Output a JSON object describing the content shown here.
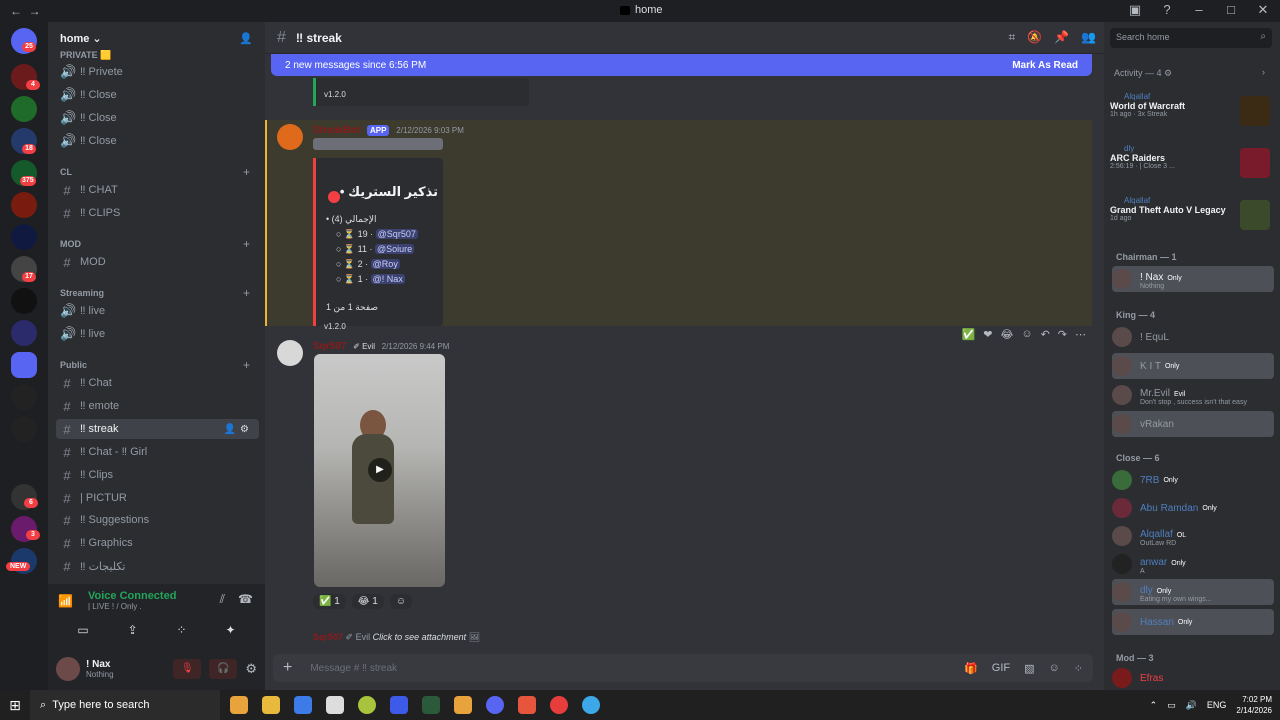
{
  "titlebar": {
    "title": "home"
  },
  "servers": {
    "dm_badge": "25",
    "badges": [
      "4",
      "18",
      "375",
      "17",
      "6",
      "3"
    ],
    "new_label": "NEW"
  },
  "guild": {
    "name": "home ⌄"
  },
  "categories": {
    "private": "PRIVATE 🟨",
    "cl": "CL",
    "mod": "MOD",
    "streaming": "Streaming",
    "public": "Public"
  },
  "channels": [
    {
      "name": "‼ Privete"
    },
    {
      "name": "‼ Close"
    },
    {
      "name": "‼ Close"
    },
    {
      "name": "‼ Close"
    },
    {
      "name": "‼ CHAT"
    },
    {
      "name": "‼ CLIPS"
    },
    {
      "name": "MOD"
    },
    {
      "name": "‼ live"
    },
    {
      "name": "‼ live"
    },
    {
      "name": "‼ Chat"
    },
    {
      "name": "‼ emote"
    },
    {
      "name": "‼ streak"
    },
    {
      "name": "‼ Chat - ‼ Girl"
    },
    {
      "name": "‼ Clips"
    },
    {
      "name": "| PICTUR"
    },
    {
      "name": "‼ Suggestions"
    },
    {
      "name": "‼ Graphics"
    },
    {
      "name": "‼ تكليجات"
    }
  ],
  "voice": {
    "status": "Voice Connected",
    "sub": "| LIVE ! / Only ."
  },
  "user": {
    "name": "! Nax",
    "status": "Nothing"
  },
  "chat": {
    "channel": "‼ streak",
    "banner": "2 new messages since 6:56 PM",
    "mark_read": "Mark As Read",
    "top_version": "v1.2.0",
    "bot_name": "StreakBot",
    "bot_tag": "APP",
    "bot_time": "2/12/2026 9:03 PM",
    "embed_title": "تذكير الستريك •",
    "embed_total": "الإجمالي (4)",
    "embed_rows": [
      {
        "count": "19",
        "mention": "@Sqr507"
      },
      {
        "count": "11",
        "mention": "@Soiure"
      },
      {
        "count": "2",
        "mention": "@Roy"
      },
      {
        "count": "1",
        "mention": "@! Nax"
      }
    ],
    "embed_page": "صفحة 1 من 1",
    "embed_version": "v1.2.0",
    "msg2_author": "Sqr507",
    "msg2_tag": "Evil",
    "msg2_time": "2/12/2026 9:44 PM",
    "reactions": [
      {
        "emoji": "✅",
        "count": "1"
      },
      {
        "emoji": "😂",
        "count": "1"
      }
    ],
    "reply_author": "Sqr507",
    "reply_tag": "Evil",
    "reply_text": "Click to see attachment",
    "composer_placeholder": "Message # ‼ streak"
  },
  "members": {
    "search_placeholder": "Search home",
    "activity_head": "Activity — 4",
    "activities": [
      {
        "who": "Alqallaf",
        "game": "World of Warcraft",
        "det": "1h ago · 3x Streak",
        "color": "#3b2a14"
      },
      {
        "who": "dly",
        "game": "ARC Raiders",
        "det": "2:56:19 · | Close 3 ...",
        "color": "#7a1b2b"
      },
      {
        "who": "Alqallaf",
        "game": "Grand Theft Auto V Legacy",
        "det": "1d ago",
        "color": "#3a4a2a"
      }
    ],
    "roles": [
      {
        "label": "Chairman — 1"
      },
      {
        "label": "King — 4"
      },
      {
        "label": "Close — 6"
      },
      {
        "label": "Mod — 3"
      }
    ],
    "people": [
      {
        "name": "! Nax",
        "pill": "Only",
        "sub": "Nothing",
        "color": "#f2f3f5"
      },
      {
        "name": "! EquL",
        "pill": "",
        "sub": "",
        "color": "#949ba4"
      },
      {
        "name": "K I T",
        "pill": "Only",
        "sub": "",
        "color": "#949ba4"
      },
      {
        "name": "Mr.Evil",
        "pill": "Evil",
        "sub": "Don't stop , success isn't that easy",
        "color": "#949ba4"
      },
      {
        "name": "vRakan",
        "pill": "",
        "sub": "",
        "color": "#949ba4"
      },
      {
        "name": "7RB",
        "pill": "Only",
        "sub": "",
        "color": "#4f7fbf"
      },
      {
        "name": "Abu Ramdan",
        "pill": "Only",
        "sub": "",
        "color": "#4f7fbf"
      },
      {
        "name": "Alqallaf",
        "pill": "OL",
        "sub": "OutLaw RD",
        "color": "#4f7fbf"
      },
      {
        "name": "anwar",
        "pill": "Only",
        "sub": "A",
        "color": "#4f7fbf"
      },
      {
        "name": "dly",
        "pill": "Only",
        "sub": "Eating my own wings...",
        "color": "#4f7fbf"
      },
      {
        "name": "Hassan",
        "pill": "Only",
        "sub": "",
        "color": "#4f7fbf"
      },
      {
        "name": "Efras",
        "pill": "",
        "sub": "",
        "color": "#f23f43"
      }
    ]
  },
  "taskbar": {
    "search": "Type here to search",
    "lang": "ENG",
    "time": "7:02 PM",
    "date": "2/14/2026"
  }
}
